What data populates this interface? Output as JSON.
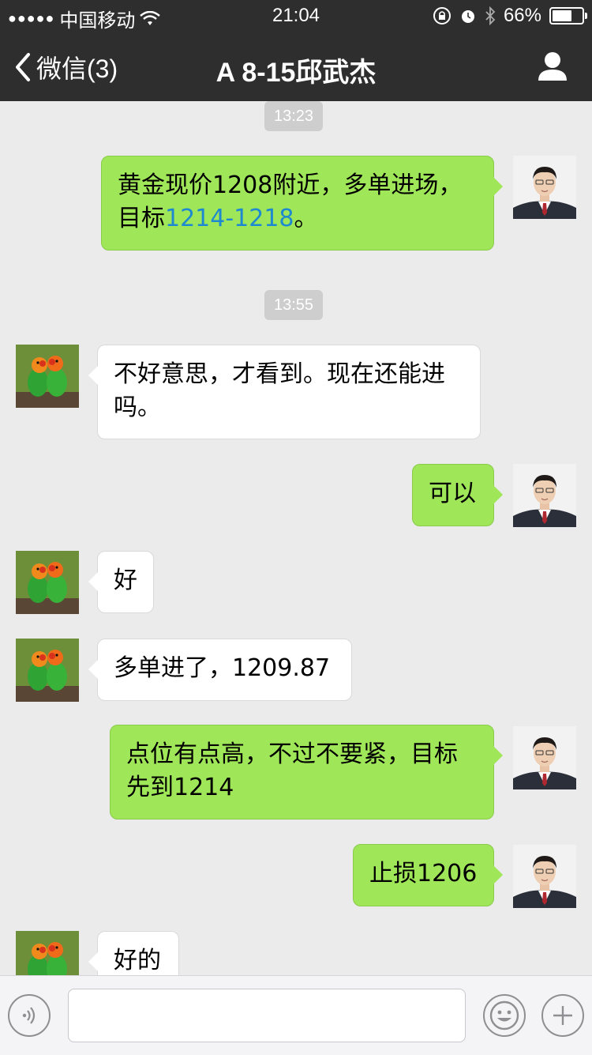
{
  "status": {
    "signal": "●●●●●",
    "carrier": "中国移动",
    "time": "21:04",
    "battery_text": "66%",
    "battery_level": 0.66
  },
  "nav": {
    "back_label": "微信(3)",
    "title": "A  8-15邱武杰"
  },
  "messages": {
    "ts1": "13:23",
    "m1a": "黄金现价1208附近，多单进场，",
    "m1b": "目标",
    "m1c": "1214-1218",
    "m1d": "。",
    "ts2": "13:55",
    "m2a": "不好意思，才看到。现在还能进",
    "m2b": "吗。",
    "m3": "可以",
    "m4": "好",
    "m5": "多单进了，1209.87",
    "m6a": "点位有点高，不过不要紧，目标",
    "m6b": "先到1214",
    "m7": "止损1206",
    "m8": "好的"
  },
  "colors": {
    "my_bubble": "#9fe658",
    "link": "#1e88d0",
    "navbar": "#2e2e2e"
  },
  "icons": [
    "wifi-icon",
    "lock-rotation-icon",
    "alarm-icon",
    "bluetooth-icon",
    "battery-icon",
    "back-chevron-icon",
    "person-icon",
    "voice-icon",
    "emoji-icon",
    "plus-icon",
    "avatar-man",
    "avatar-parrots"
  ]
}
